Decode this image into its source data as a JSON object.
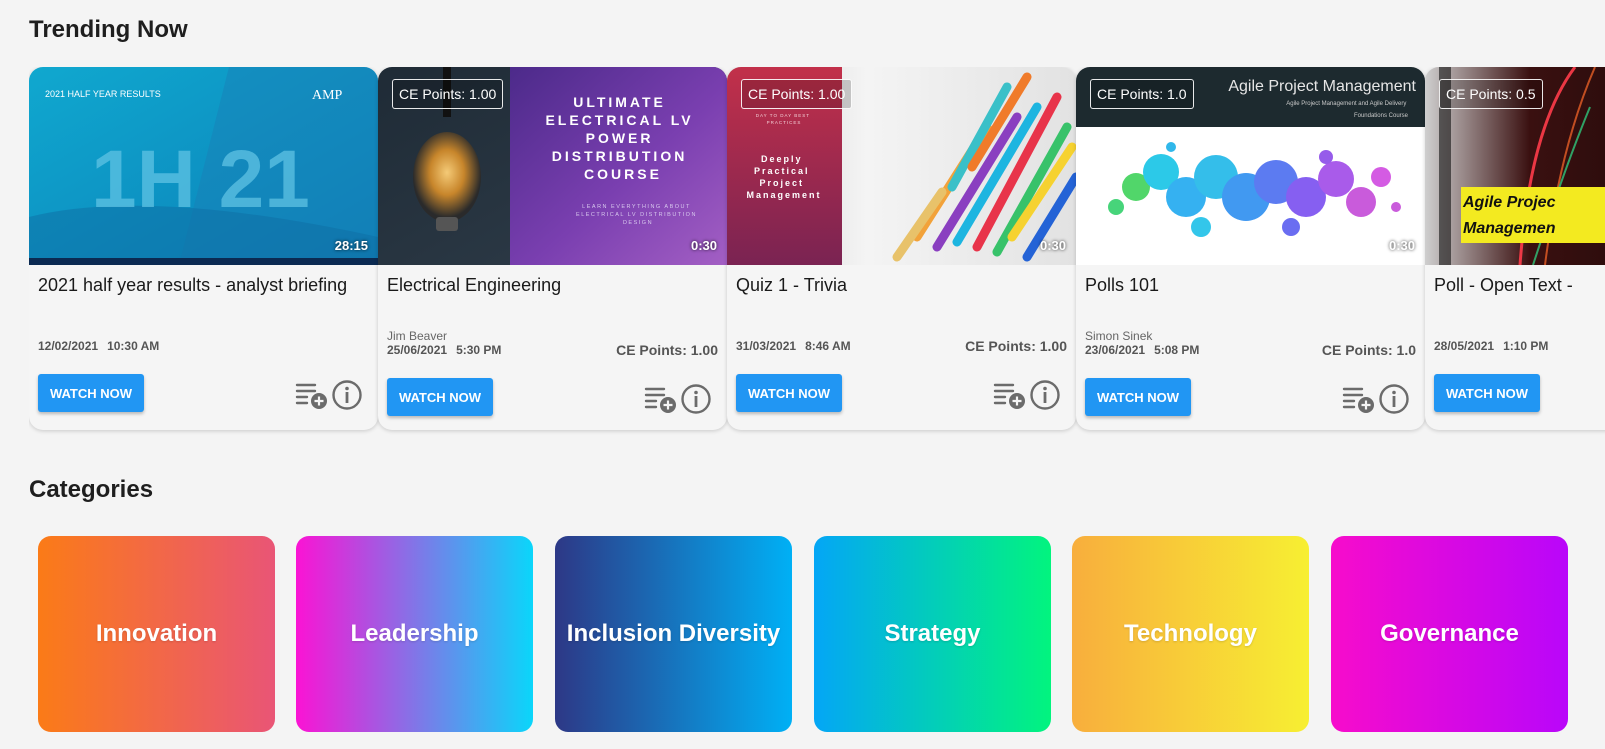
{
  "sections": {
    "trending_title": "Trending Now",
    "categories_title": "Categories"
  },
  "trending": [
    {
      "thumb_label": "2021 HALF YEAR RESULTS",
      "thumb_logo": "AMP",
      "thumb_headline": "1H 21",
      "duration": "28:15",
      "title": "2021 half year results - analyst briefing",
      "date": "12/02/2021",
      "time": "10:30 AM",
      "button": "WATCH NOW"
    },
    {
      "ce_badge": "CE Points: 1.00",
      "thumb_headline_lines": [
        "ULTIMATE",
        "ELECTRICAL LV",
        "POWER",
        "DISTRIBUTION",
        "COURSE"
      ],
      "thumb_sub_lines": [
        "LEARN EVERYTHING ABOUT",
        "ELECTRICAL LV DISTRIBUTION",
        "DESIGN"
      ],
      "duration": "0:30",
      "title": "Electrical Engineering",
      "presenter": "Jim Beaver",
      "date": "25/06/2021",
      "time": "5:30 PM",
      "ce_points": "CE Points: 1.00",
      "button": "WATCH NOW"
    },
    {
      "ce_badge": "CE Points: 1.00",
      "thumb_small": [
        "DAY TO DAY BEST",
        "PRACTICES"
      ],
      "thumb_headline_lines": [
        "Deeply",
        "Practical",
        "Project",
        "Management"
      ],
      "duration": "0:30",
      "title": "Quiz 1 - Trivia",
      "date": "31/03/2021",
      "time": "8:46 AM",
      "ce_points": "CE Points: 1.00",
      "button": "WATCH NOW"
    },
    {
      "ce_badge": "CE Points: 1.0",
      "thumb_headline": "Agile Project Management",
      "thumb_sub_lines": [
        "Agile Project Management and Agile Delivery",
        "Foundations Course"
      ],
      "duration": "0:30",
      "title": "Polls 101",
      "presenter": "Simon Sinek",
      "date": "23/06/2021",
      "time": "5:08 PM",
      "ce_points": "CE Points: 1.0",
      "button": "WATCH NOW"
    },
    {
      "ce_badge": "CE Points: 0.5",
      "thumb_headline_lines": [
        "Agile Projec",
        "Managemen"
      ],
      "title": "Poll - Open Text - ",
      "date": "28/05/2021",
      "time": "1:10 PM",
      "button": "WATCH NOW"
    }
  ],
  "categories": [
    {
      "label": "Innovation",
      "gradient": [
        "#fb7b17",
        "#e95576"
      ]
    },
    {
      "label": "Leadership",
      "gradient": [
        "#fb13d4",
        "#0ad6fa"
      ]
    },
    {
      "label": "Inclusion Diversity",
      "gradient": [
        "#2d3886",
        "#00b0f5"
      ]
    },
    {
      "label": "Strategy",
      "gradient": [
        "#04a6f6",
        "#02f47e"
      ]
    },
    {
      "label": "Technology",
      "gradient": [
        "#f8ae3d",
        "#f7ef32"
      ]
    },
    {
      "label": "Governance",
      "gradient": [
        "#f70ccb",
        "#b906fa"
      ]
    }
  ],
  "colors": {
    "accent_button": "#2196f3",
    "background": "#f4f4f4"
  }
}
